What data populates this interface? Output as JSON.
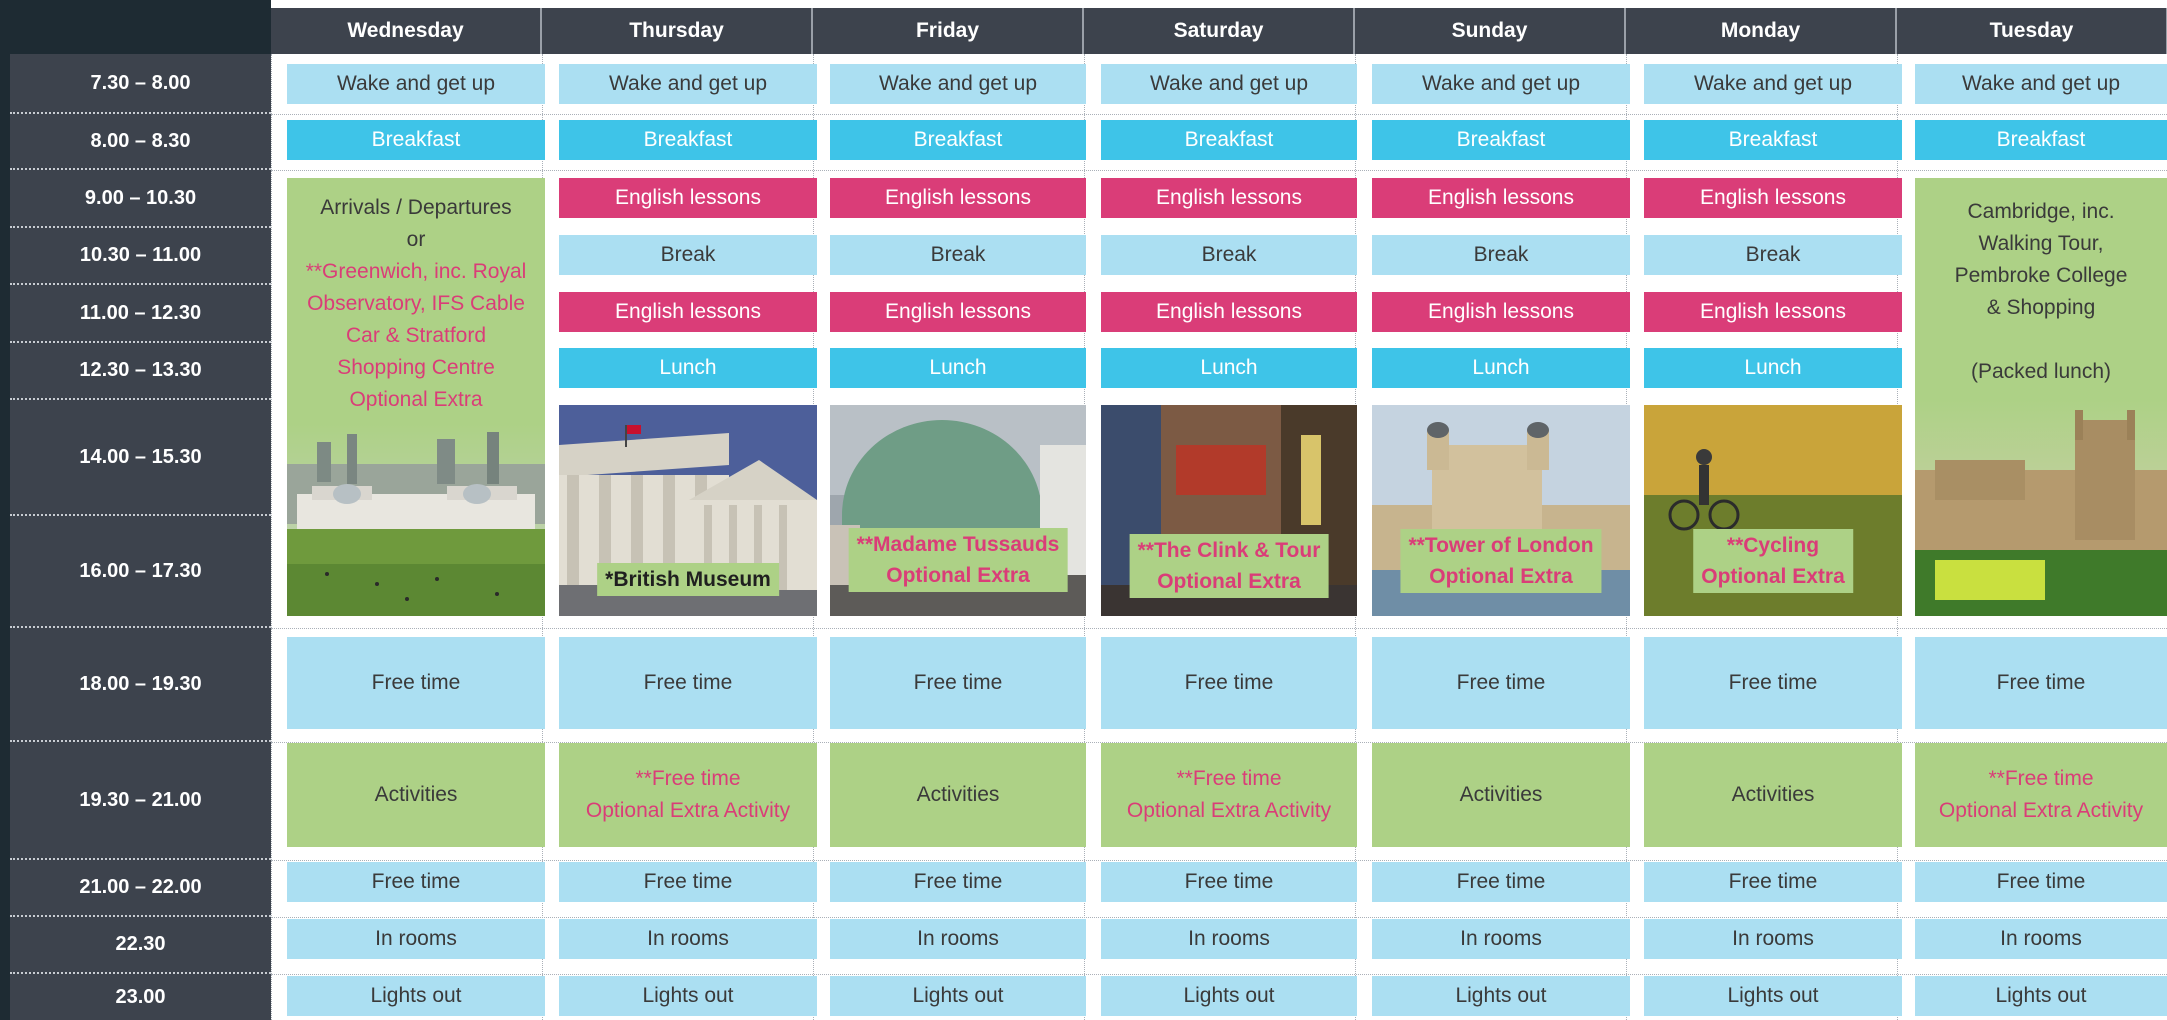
{
  "days": [
    "Wednesday",
    "Thursday",
    "Friday",
    "Saturday",
    "Sunday",
    "Monday",
    "Tuesday"
  ],
  "times": [
    "7.30 – 8.00",
    "8.00 – 8.30",
    "9.00 – 10.30",
    "10.30 – 11.00",
    "11.00 – 12.30",
    "12.30 – 13.30",
    "14.00 – 15.30",
    "16.00 – 17.30",
    "18.00 – 19.30",
    "19.30 – 21.00",
    "21.00 – 22.00",
    "22.30",
    "23.00"
  ],
  "common": {
    "wake": "Wake and get up",
    "breakfast": "Breakfast",
    "english": "English lessons",
    "break": "Break",
    "lunch": "Lunch",
    "free_time": "Free time",
    "activities": "Activities",
    "in_rooms": "In rooms",
    "lights_out": "Lights out",
    "free_time_extra_line1": "**Free time",
    "free_time_extra_line2": "Optional Extra Activity"
  },
  "wednesday": {
    "line1": "Arrivals / Departures",
    "line2": "or",
    "pink_lines": [
      "**Greenwich, inc. Royal",
      "Observatory, IFS Cable",
      "Car & Stratford",
      "Shopping Centre",
      "Optional Extra"
    ]
  },
  "tuesday": {
    "lines": [
      "Cambridge, inc.",
      "Walking Tour,",
      "Pembroke College",
      "& Shopping",
      "",
      "(Packed lunch)"
    ]
  },
  "excursions": {
    "thursday": [
      "*British Museum"
    ],
    "friday": [
      "**Madame Tussauds",
      "Optional Extra"
    ],
    "saturday": [
      "**The Clink & Tour",
      "Optional Extra"
    ],
    "sunday": [
      "**Tower of London",
      "Optional Extra"
    ],
    "monday": [
      "**Cycling",
      "Optional Extra"
    ]
  },
  "colors": {
    "header_bg": "#3d434d",
    "light_blue": "#abdff2",
    "cyan": "#3ec4e8",
    "pink": "#da3d78",
    "green": "#add186"
  }
}
